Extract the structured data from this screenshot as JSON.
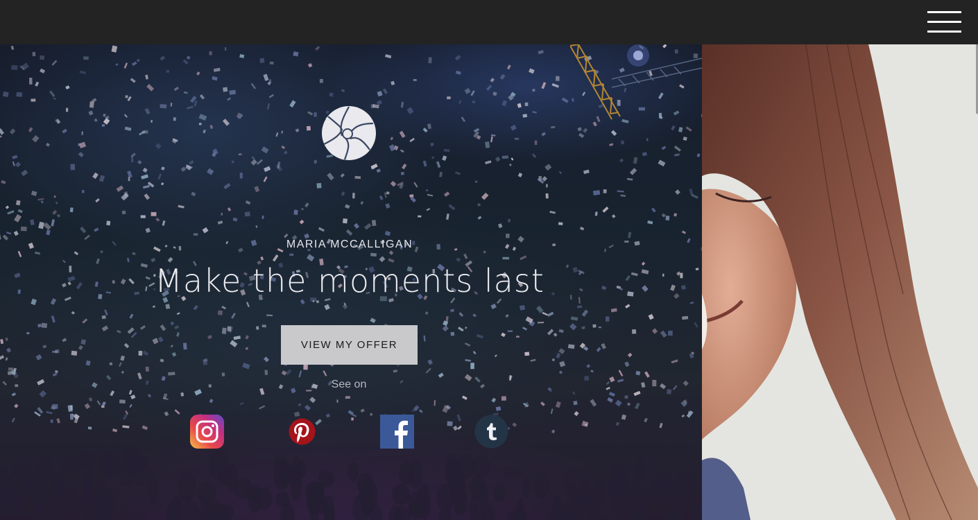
{
  "header": {
    "menu_icon": "hamburger-menu-icon"
  },
  "hero": {
    "logo_icon": "camera-aperture-icon",
    "subtitle": "MARIA MCCALLIGAN",
    "headline": "Make the moments last",
    "cta_label": "VIEW MY OFFER",
    "see_on_label": "See on",
    "social": [
      {
        "name": "instagram",
        "icon": "instagram-icon",
        "color": "#d6306a"
      },
      {
        "name": "pinterest",
        "icon": "pinterest-icon",
        "color": "#b5161d"
      },
      {
        "name": "facebook",
        "icon": "facebook-icon",
        "color": "#3b5998"
      },
      {
        "name": "tumblr",
        "icon": "tumblr-icon",
        "color": "#243447"
      }
    ]
  },
  "colors": {
    "header_bg": "#232323",
    "button_bg": "#c9c9cb",
    "text_light": "#ececf0"
  }
}
